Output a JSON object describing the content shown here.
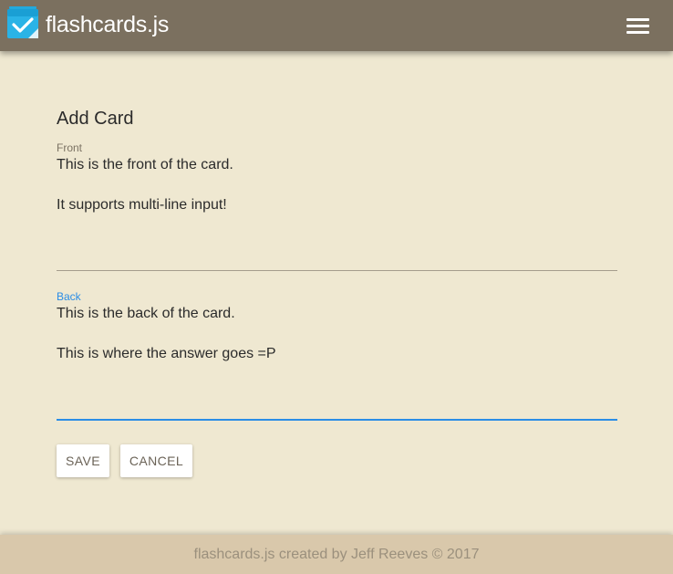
{
  "header": {
    "app_title": "flashcards.js",
    "logo_icon": "checked-card-icon",
    "menu_icon": "hamburger-menu-icon",
    "background_color": "#7b705f",
    "logo_color": "#2ab3e6"
  },
  "form": {
    "heading": "Add Card",
    "front": {
      "label": "Front",
      "value": "This is the front of the card.\n\nIt supports multi-line input!"
    },
    "back": {
      "label": "Back",
      "value": "This is the back of the card.\n\nThis is where the answer goes =P"
    },
    "save_label": "SAVE",
    "cancel_label": "CANCEL",
    "accent_color": "#2a8de6"
  },
  "footer": {
    "text": "flashcards.js created by Jeff Reeves © 2017",
    "background_color": "#d9c8ab"
  },
  "page": {
    "background_color": "#efe8d1"
  }
}
